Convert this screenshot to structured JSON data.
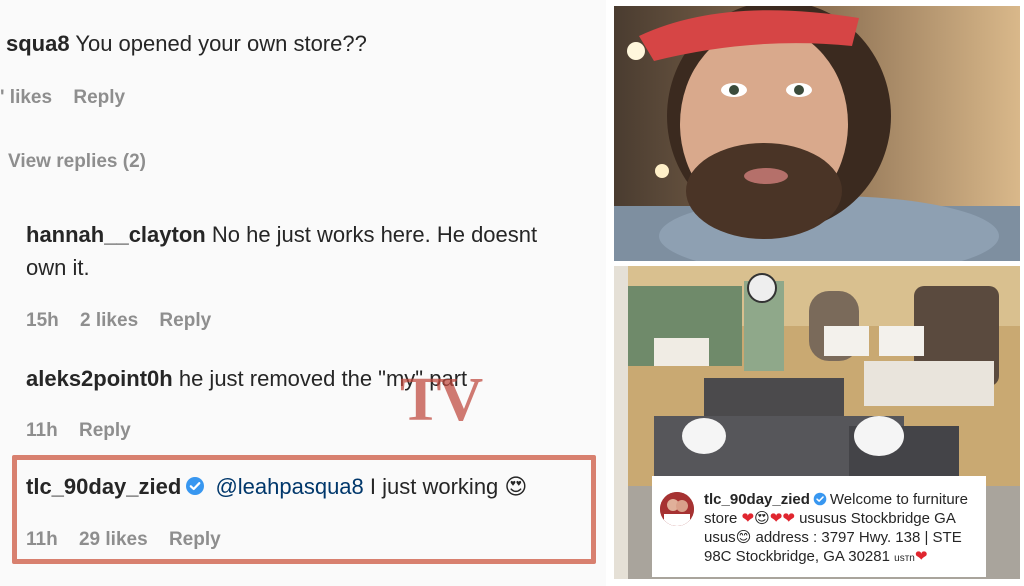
{
  "comments": [
    {
      "user": "squa8",
      "text": "You opened your own store??",
      "time": "",
      "likes": "' likes",
      "reply": "Reply"
    },
    {
      "view_replies": "View replies (2)"
    },
    {
      "user": "hannah__clayton",
      "text": "No he just works here. He doesnt",
      "text2": "own it.",
      "time": "15h",
      "likes": "2 likes",
      "reply": "Reply"
    },
    {
      "user": "aleks2point0h",
      "text": "he just removed the \"my\" part",
      "time": "11h",
      "likes": "",
      "reply": "Reply"
    },
    {
      "user": "tlc_90day_zied",
      "mention": "@leahpasqua8",
      "text": "I just working",
      "emoji": "😍",
      "time": "11h",
      "likes": "29 likes",
      "reply": "Reply"
    }
  ],
  "watermark": "TV",
  "caption": {
    "user": "tlc_90day_zied",
    "line1": "Welcome to furniture",
    "line2_a": "store",
    "line2_b": "ususus Stockbridge GA",
    "line3_a": "usus",
    "line3_b": "address : 3797 Hwy. 138 | STE",
    "line4": "98C Stockbridge, GA 30281",
    "line4_b": "usтn"
  },
  "colors": {
    "highlight_border": "#d8806f",
    "verified_blue": "#3897f0",
    "heart_red": "#e0262f",
    "meta_gray": "#8e8e8e"
  }
}
